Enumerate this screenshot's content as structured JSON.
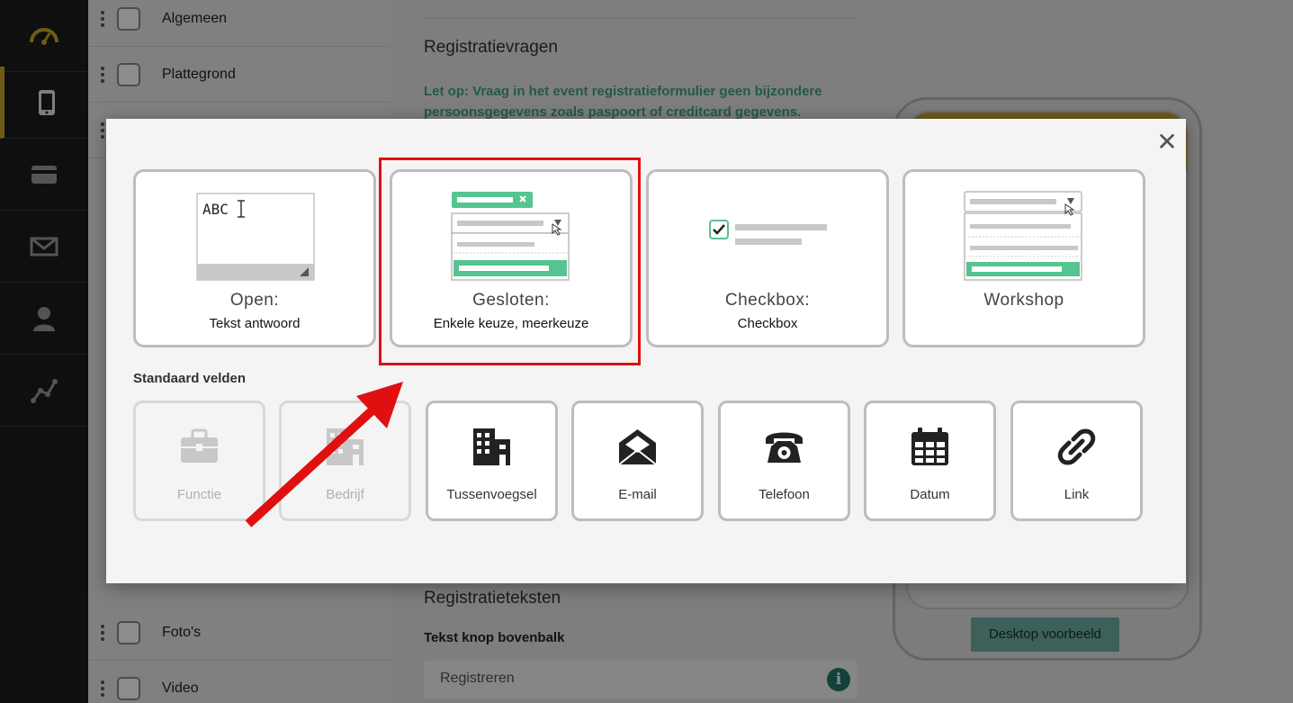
{
  "sidebar_list": {
    "items": [
      {
        "label": "Algemeen"
      },
      {
        "label": "Plattegrond"
      },
      {
        "label": "Foto's"
      },
      {
        "label": "Video"
      }
    ]
  },
  "main": {
    "section_title": "Registratievragen",
    "warning": "Let op: Vraag in het event registratieformulier geen bijzondere persoonsgegevens zoals paspoort of creditcard gegevens.",
    "texts_title": "Registratieteksten",
    "button_text_label": "Tekst knop bovenbalk",
    "button_text_value": "Registreren",
    "desktop_preview": "Desktop voorbeeld"
  },
  "modal": {
    "close": "✕",
    "question_types": [
      {
        "title": "Open:",
        "subtitle": "Tekst antwoord",
        "sample": "ABC"
      },
      {
        "title": "Gesloten:",
        "subtitle": "Enkele keuze, meerkeuze"
      },
      {
        "title": "Checkbox:",
        "subtitle": "Checkbox"
      },
      {
        "title": "Workshop",
        "subtitle": ""
      }
    ],
    "standard_fields_title": "Standaard velden",
    "standard_fields": [
      {
        "label": "Functie",
        "icon": "briefcase-icon",
        "disabled": true
      },
      {
        "label": "Bedrijf",
        "icon": "building-icon",
        "disabled": true
      },
      {
        "label": "Tussenvoegsel",
        "icon": "buildings-icon",
        "disabled": false
      },
      {
        "label": "E-mail",
        "icon": "envelope-icon",
        "disabled": false
      },
      {
        "label": "Telefoon",
        "icon": "telephone-icon",
        "disabled": false
      },
      {
        "label": "Datum",
        "icon": "calendar-icon",
        "disabled": false
      },
      {
        "label": "Link",
        "icon": "link-icon",
        "disabled": false
      }
    ]
  },
  "colors": {
    "accent_gold": "#c9a62a",
    "accent_green": "#3da77a",
    "highlight_red": "#e01010"
  }
}
